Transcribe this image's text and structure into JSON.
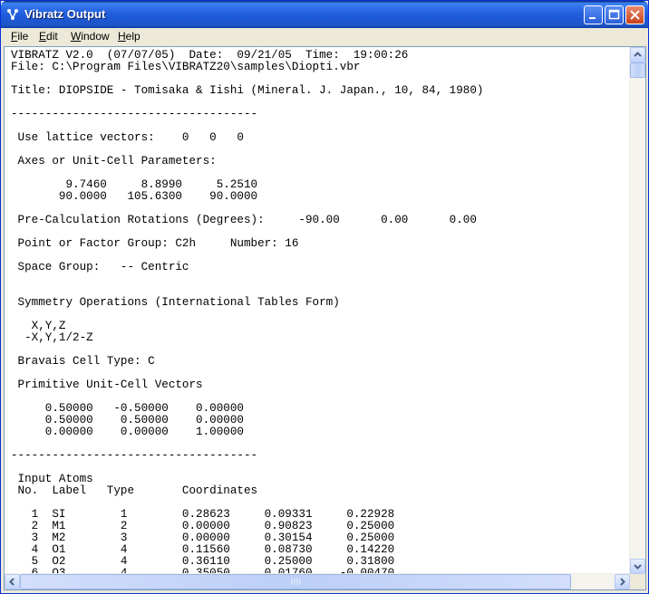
{
  "window": {
    "title": "Vibratz Output"
  },
  "menu": [
    {
      "first": "F",
      "rest": "ile"
    },
    {
      "first": "E",
      "rest": "dit"
    },
    {
      "first": "W",
      "rest": "indow"
    },
    {
      "first": "H",
      "rest": "elp"
    }
  ],
  "lines": [
    "VIBRATZ V2.0  (07/07/05)  Date:  09/21/05  Time:  19:00:26",
    "File: C:\\Program Files\\VIBRATZ20\\samples\\Diopti.vbr",
    "",
    "Title: DIOPSIDE - Tomisaka & Iishi (Mineral. J. Japan., 10, 84, 1980)",
    "",
    "------------------------------------",
    "",
    " Use lattice vectors:    0   0   0",
    "",
    " Axes or Unit-Cell Parameters:",
    "",
    "        9.7460     8.8990     5.2510",
    "       90.0000   105.6300    90.0000",
    "",
    " Pre-Calculation Rotations (Degrees):     -90.00      0.00      0.00",
    "",
    " Point or Factor Group: C2h     Number: 16",
    "",
    " Space Group:   -- Centric",
    "",
    "",
    " Symmetry Operations (International Tables Form)",
    "",
    "   X,Y,Z",
    "  -X,Y,1/2-Z",
    "",
    " Bravais Cell Type: C",
    "",
    " Primitive Unit-Cell Vectors",
    "",
    "     0.50000   -0.50000    0.00000",
    "     0.50000    0.50000    0.00000",
    "     0.00000    0.00000    1.00000",
    "",
    "------------------------------------",
    "",
    " Input Atoms",
    " No.  Label   Type       Coordinates",
    "",
    "   1  SI        1        0.28623     0.09331     0.22928",
    "   2  M1        2        0.00000     0.90823     0.25000",
    "   3  M2        3        0.00000     0.30154     0.25000",
    "   4  O1        4        0.11560     0.08730     0.14220",
    "   5  O2        4        0.36110     0.25000     0.31800",
    "   6  O3        4        0.35050     0.01760    -0.00470"
  ]
}
